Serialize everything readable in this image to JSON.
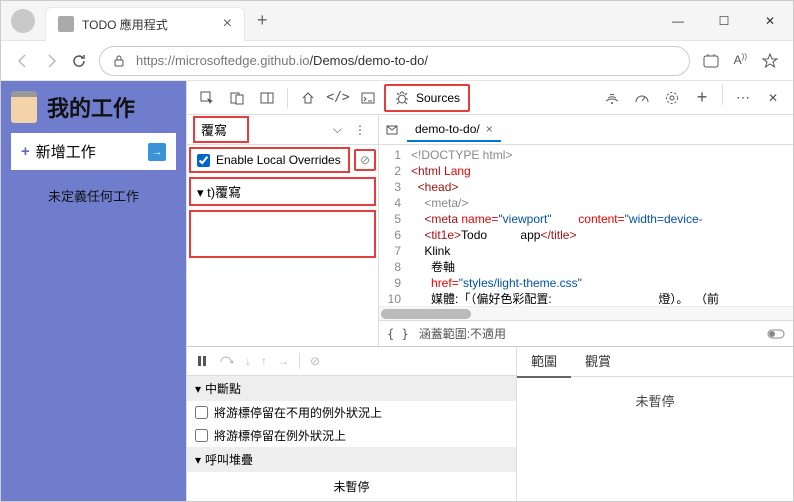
{
  "browser": {
    "tab_title": "TODO 應用程式",
    "url_host": "https://microsoftedge.github.io",
    "url_path": "/Demos/demo-to-do/"
  },
  "app": {
    "title": "我的工作",
    "add_task": "新增工作",
    "no_task": "未定義任何工作"
  },
  "devtools": {
    "active_panel": "Sources",
    "overrides_dropdown": "覆寫",
    "enable_overrides": "Enable Local Overrides",
    "tree_item": "t)覆寫",
    "file_tab": "demo-to-do/",
    "code_lines": [
      "<!DOCTYPE html>",
      "<html Lang",
      "  <head>",
      "    <meta/>",
      "    <meta name=\"viewport\"        content=\"width=device-",
      "    <title>Todo          app</title>",
      "    Klink",
      "      卷軸",
      "      href=\"styles/light-theme.css\"",
      "      媒體:「（偏好色彩配置:                                燈）。  （前"
    ],
    "line_numbers": [
      1,
      2,
      3,
      4,
      5,
      6,
      7,
      8,
      9,
      10
    ],
    "coverage": "涵蓋範圍:不適用"
  },
  "debug": {
    "breakpoints_header": "中斷點",
    "bp1": "將游標停留在不用的例外狀況上",
    "bp2": "將游標停留在例外狀況上",
    "callstack_header": "呼叫堆疊",
    "not_paused": "未暫停",
    "scope_tab": "範圍",
    "watch_tab": "觀賞",
    "scope_body": "未暫停"
  }
}
